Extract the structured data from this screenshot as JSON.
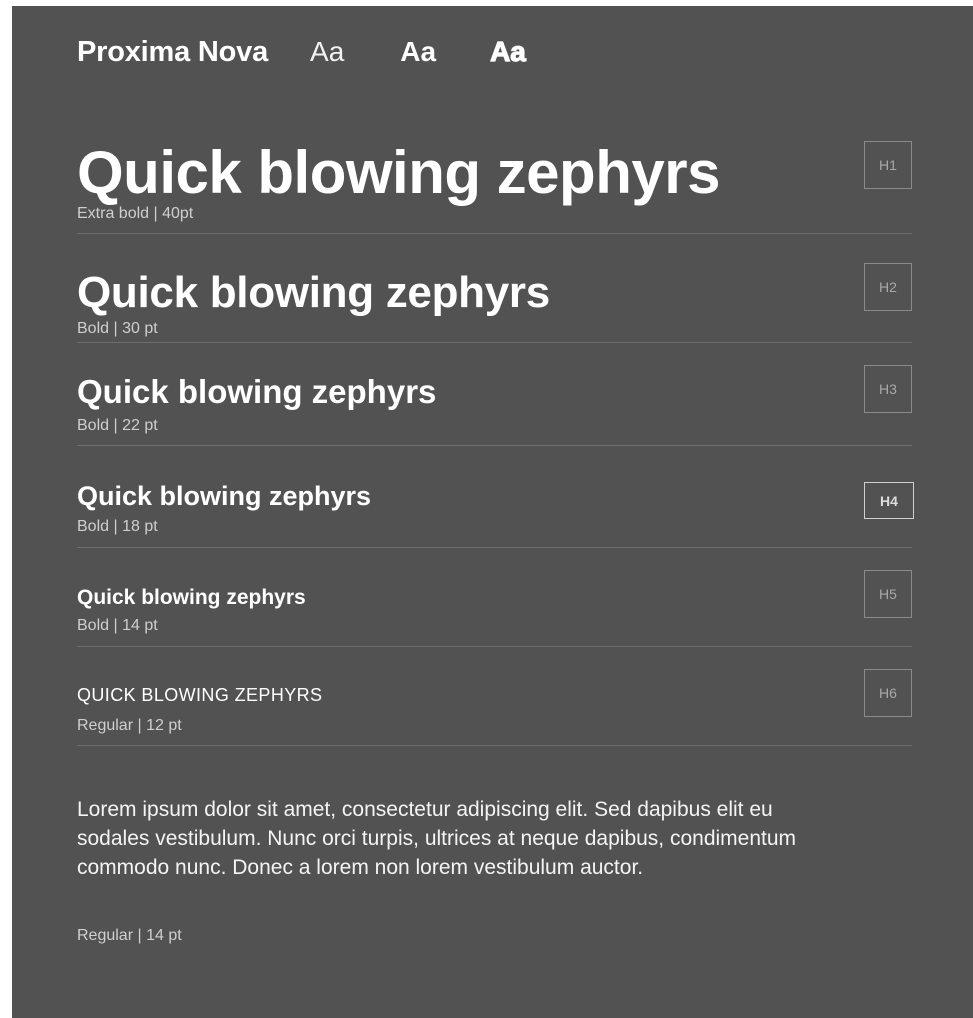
{
  "header": {
    "font_name": "Proxima Nova",
    "samples": [
      "Aa",
      "Aa",
      "Aa"
    ]
  },
  "headings": [
    {
      "tag": "H1",
      "text": "Quick blowing zephyrs",
      "spec": "Extra bold | 40pt"
    },
    {
      "tag": "H2",
      "text": "Quick blowing zephyrs",
      "spec": "Bold | 30 pt"
    },
    {
      "tag": "H3",
      "text": "Quick blowing zephyrs",
      "spec": "Bold | 22 pt"
    },
    {
      "tag": "H4",
      "text": "Quick blowing zephyrs",
      "spec": "Bold | 18 pt"
    },
    {
      "tag": "H5",
      "text": "Quick blowing zephyrs",
      "spec": "Bold | 14 pt"
    },
    {
      "tag": "H6",
      "text": "QUICK BLOWING ZEPHYRS",
      "spec": "Regular | 12 pt"
    }
  ],
  "body": {
    "text": "Lorem ipsum dolor sit amet, consectetur adipiscing elit. Sed dapibus elit eu sodales vestibulum. Nunc orci turpis, ultrices at neque dapibus, condimentum commodo nunc. Donec a lorem non lorem vestibulum auctor.",
    "spec": "Regular | 14 pt"
  },
  "colors": {
    "background": "#525252",
    "text": "#ffffff",
    "muted": "#cfcfcf",
    "divider": "#6e6e6e"
  }
}
